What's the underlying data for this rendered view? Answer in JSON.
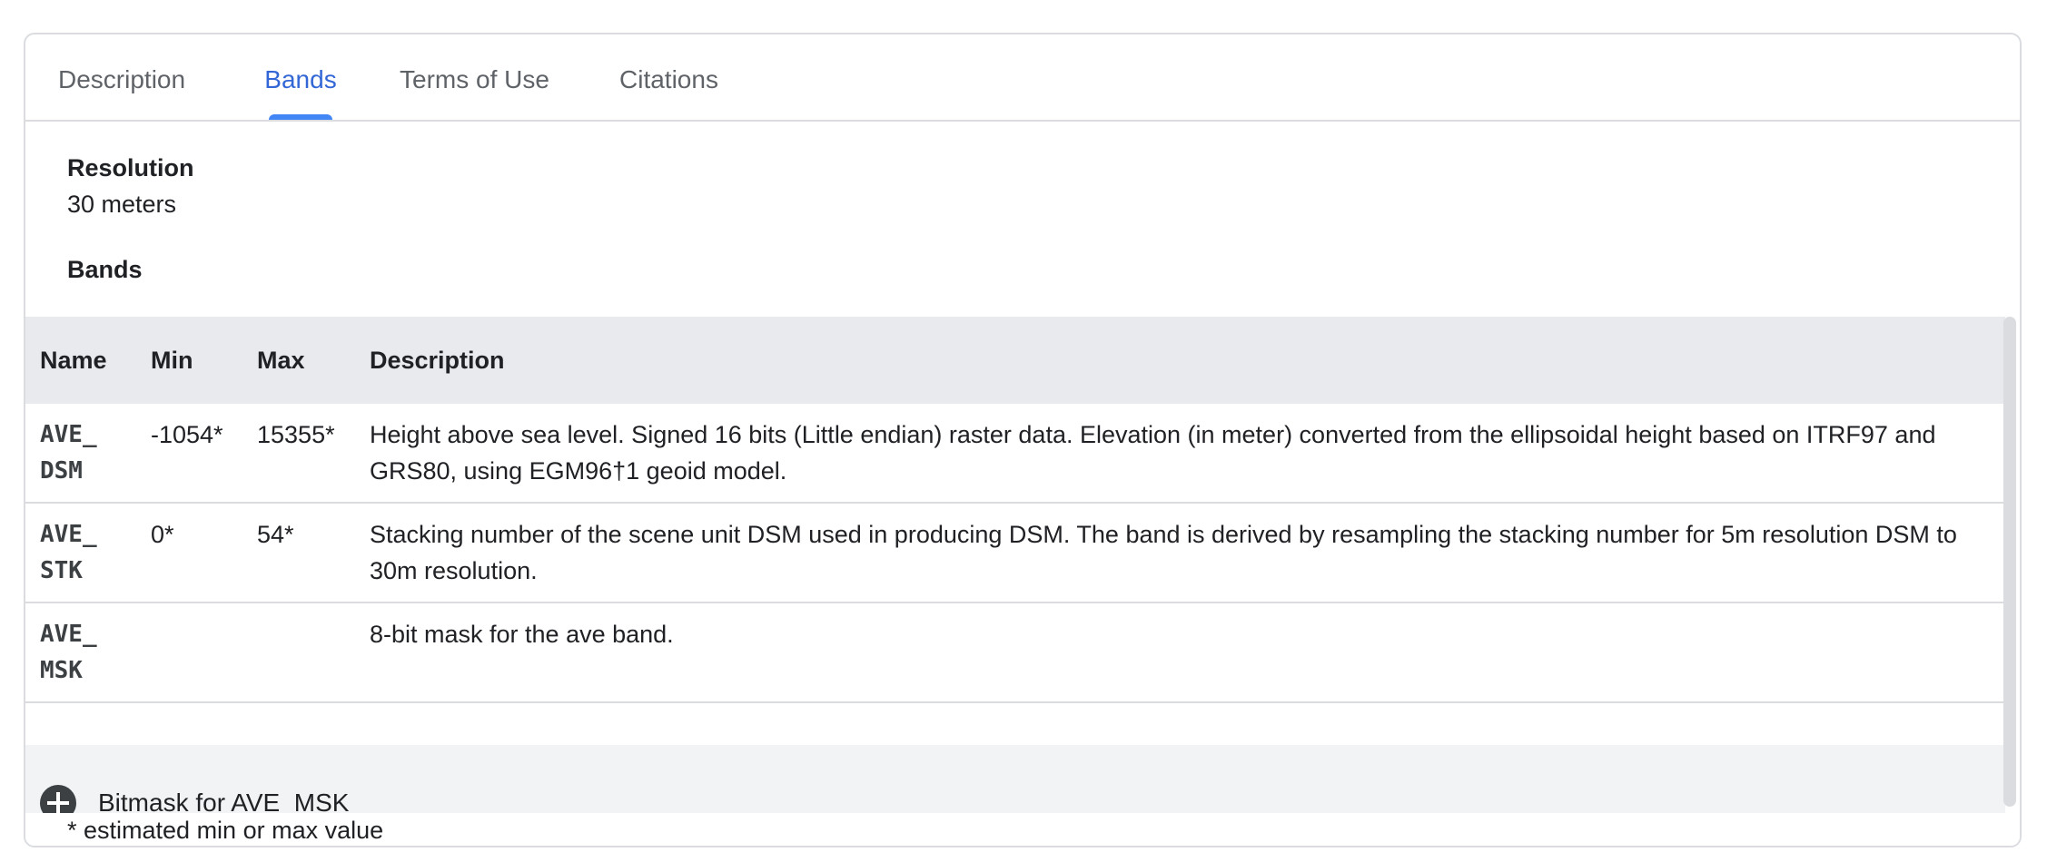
{
  "tabs": [
    {
      "label": "Description",
      "active": false
    },
    {
      "label": "Bands",
      "active": true
    },
    {
      "label": "Terms of Use",
      "active": false
    },
    {
      "label": "Citations",
      "active": false
    }
  ],
  "resolution": {
    "label": "Resolution",
    "value": "30 meters"
  },
  "bands_section": {
    "label": "Bands"
  },
  "table": {
    "headers": [
      "Name",
      "Min",
      "Max",
      "Description"
    ],
    "rows": [
      {
        "name_line1": "AVE_",
        "name_line2": "DSM",
        "min": "-1054*",
        "max": "15355*",
        "description": "Height above sea level. Signed 16 bits (Little endian) raster data. Elevation (in meter) converted from the ellipsoidal height based on ITRF97 and GRS80, using EGM96†1 geoid model."
      },
      {
        "name_line1": "AVE_",
        "name_line2": "STK",
        "min": "0*",
        "max": "54*",
        "description": "Stacking number of the scene unit DSM used in producing DSM. The band is derived by resampling the stacking number for 5m resolution DSM to 30m resolution."
      },
      {
        "name_line1": "AVE_",
        "name_line2": "MSK",
        "min": "",
        "max": "",
        "description": "8-bit mask for the ave band."
      }
    ]
  },
  "bitmask": {
    "label": "Bitmask for AVE_MSK",
    "icon": "plus-circle-icon"
  },
  "footnote": "* estimated min or max value",
  "colors": {
    "accent": "#3367d6",
    "indicator": "#4285f4",
    "header_bg": "#e8eaed",
    "border": "#dadce0"
  }
}
